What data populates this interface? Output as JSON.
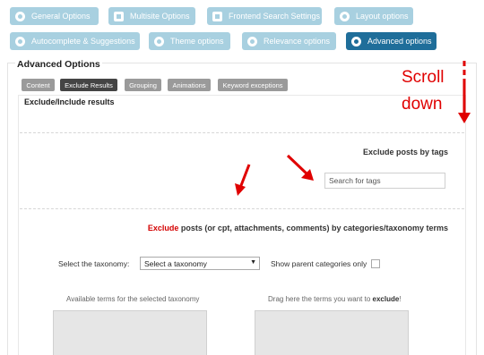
{
  "top_tabs": [
    {
      "label": "General Options",
      "icon": "gear-icon"
    },
    {
      "label": "Multisite Options",
      "icon": "multisite-icon"
    },
    {
      "label": "Frontend Search Settings",
      "icon": "frontend-icon"
    },
    {
      "label": "Layout options",
      "icon": "layout-icon"
    },
    {
      "label": "Autocomplete & Suggestions",
      "icon": "location-icon"
    },
    {
      "label": "Theme options",
      "icon": "eye-icon"
    },
    {
      "label": "Relevance options",
      "icon": "relevance-icon"
    },
    {
      "label": "Advanced options",
      "icon": "advanced-gear-icon",
      "active": true
    }
  ],
  "panel": {
    "title": "Advanced Options"
  },
  "sub_tabs": [
    {
      "label": "Content"
    },
    {
      "label": "Exclude Results",
      "active": true
    },
    {
      "label": "Grouping"
    },
    {
      "label": "Animations"
    },
    {
      "label": "Keyword exceptions"
    }
  ],
  "section": {
    "title": "Exclude/Include results",
    "exclude_tags_label": "Exclude posts by tags",
    "tags_placeholder": "Search for tags",
    "exclude_word": "Exclude",
    "categories_rest": " posts (or cpt, attachments, comments) by categories/taxonomy terms",
    "taxonomy_label": "Select the taxonomy:",
    "taxonomy_value": "Select a taxonomy",
    "show_parent_label": "Show parent categories only",
    "available_label": "Available terms for the selected taxonomy",
    "drag_prefix": "Drag here the terms you want to ",
    "drag_exclude": "exclude",
    "drag_suffix": "!"
  },
  "annotation": {
    "line1": "Scroll",
    "line2": "down",
    "color": "#e00000"
  }
}
